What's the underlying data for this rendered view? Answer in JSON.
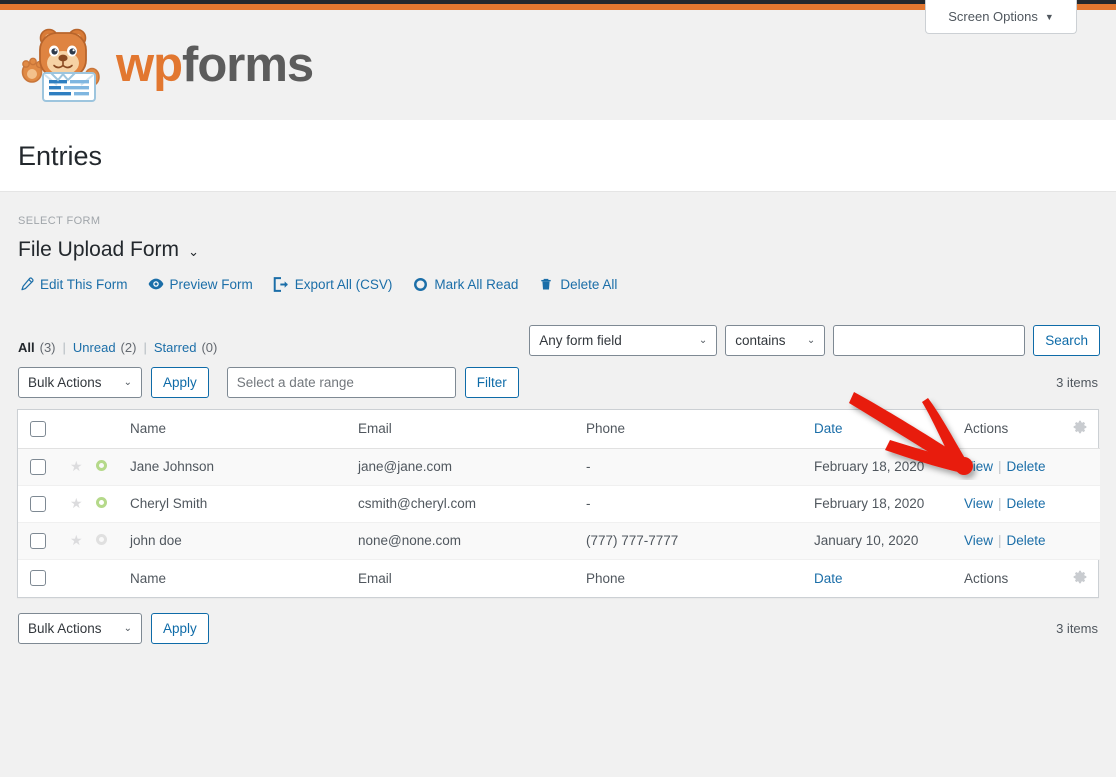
{
  "admin": {
    "screen_options_label": "Screen Options",
    "screen_options_caret": "▼"
  },
  "brand": {
    "logo_wp": "wp",
    "logo_forms": "forms",
    "mascot_icon": "wpforms-bear-mascot-icon"
  },
  "page": {
    "title": "Entries"
  },
  "form_picker": {
    "label": "SELECT FORM",
    "selected": "File Upload Form",
    "caret": "⌄"
  },
  "form_actions": [
    {
      "label": "Edit This Form",
      "icon": "pencil-icon"
    },
    {
      "label": "Preview Form",
      "icon": "eye-icon"
    },
    {
      "label": "Export All (CSV)",
      "icon": "export-icon"
    },
    {
      "label": "Mark All Read",
      "icon": "circle-o-icon"
    },
    {
      "label": "Delete All",
      "icon": "trash-icon"
    }
  ],
  "views": {
    "separator": "|",
    "items": [
      {
        "label": "All",
        "count": "(3)",
        "current": true
      },
      {
        "label": "Unread",
        "count": "(2)",
        "current": false
      },
      {
        "label": "Starred",
        "count": "(0)",
        "current": false
      }
    ]
  },
  "tablenav_top": {
    "bulk_actions_label": "Bulk Actions",
    "bulk_caret": "⌄",
    "apply_label": "Apply",
    "date_range_placeholder": "Select a date range",
    "date_range_value": "",
    "filter_label": "Filter",
    "items_count": "3 items"
  },
  "search": {
    "field_select": "Any form field",
    "field_caret": "⌄",
    "compare_select": "contains",
    "compare_caret": "⌄",
    "term_value": "",
    "term_placeholder": "",
    "search_label": "Search"
  },
  "table": {
    "columns": {
      "name": "Name",
      "email": "Email",
      "phone": "Phone",
      "date": "Date",
      "actions": "Actions",
      "gear_icon": "gear-icon",
      "select_all_icon": "checkbox-icon"
    },
    "rows": [
      {
        "name": "Jane Johnson",
        "email": "jane@jane.com",
        "phone": "-",
        "date": "February 18, 2020",
        "view": "View",
        "separator": "|",
        "delete": "Delete",
        "unread": true,
        "starred": false
      },
      {
        "name": "Cheryl Smith",
        "email": "csmith@cheryl.com",
        "phone": "-",
        "date": "February 18, 2020",
        "view": "View",
        "separator": "|",
        "delete": "Delete",
        "unread": true,
        "starred": false
      },
      {
        "name": "john doe",
        "email": "none@none.com",
        "phone": "(777) 777-7777",
        "date": "January 10, 2020",
        "view": "View",
        "separator": "|",
        "delete": "Delete",
        "unread": false,
        "starred": false
      }
    ]
  },
  "tablenav_bottom": {
    "bulk_actions_label": "Bulk Actions",
    "bulk_caret": "⌄",
    "apply_label": "Apply",
    "items_count": "3 items"
  },
  "annotation": {
    "arrow_icon": "red-arrow-annotation-icon",
    "arrow_color": "#e81c0f",
    "points_to": "View"
  },
  "colors": {
    "admin_bar": "#23282d",
    "accent_orange": "#e27730",
    "link_blue": "#1b6ea8",
    "page_bg": "#f1f1f1",
    "unread_green": "#b5d98a"
  }
}
